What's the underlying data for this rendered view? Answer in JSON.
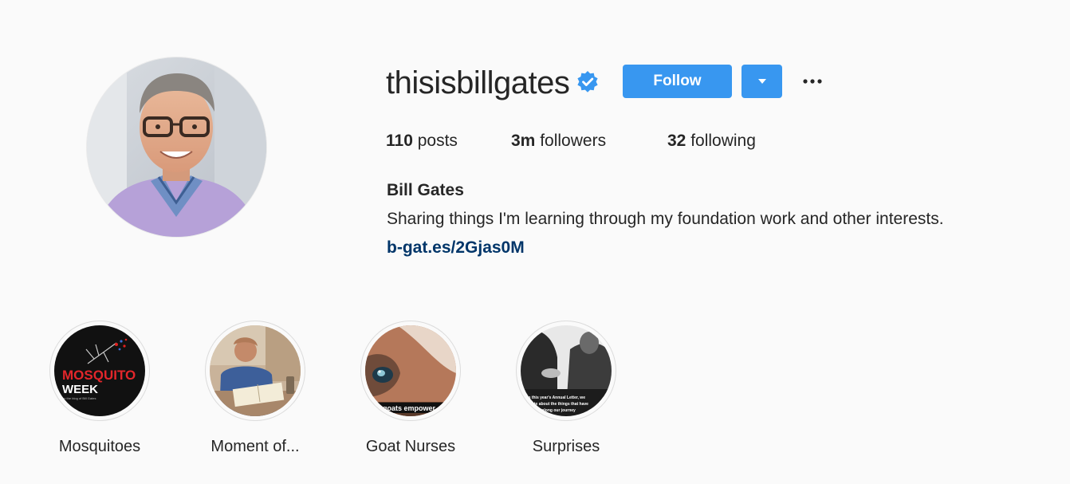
{
  "profile": {
    "username": "thisisbillgates",
    "verified": true,
    "follow_label": "Follow",
    "stats": {
      "posts_count": "110",
      "posts_label": "posts",
      "followers_count": "3m",
      "followers_label": "followers",
      "following_count": "32",
      "following_label": "following"
    },
    "full_name": "Bill Gates",
    "bio": "Sharing things I'm learning through my foundation work and other interests.",
    "link": "b-gat.es/2Gjas0M"
  },
  "highlights": [
    {
      "label": "Mosquitoes",
      "cover": {
        "title_line1": "MOSQUITO",
        "title_line2": "WEEK",
        "subtitle": "on the blog of Bill Gates"
      }
    },
    {
      "label": "Moment of..."
    },
    {
      "label": "Goat Nurses",
      "cover": {
        "caption": "g goats empower"
      }
    },
    {
      "label": "Surprises",
      "cover": {
        "caption_line1": "In this year's Annual Letter, we",
        "caption_line2": "wrote about the things that have",
        "caption_line3": "ised us along our journey"
      }
    }
  ],
  "colors": {
    "accent": "#3897f0",
    "link": "#003569",
    "background": "#fafafa",
    "text": "#262626"
  },
  "icons": {
    "verified": "verified-badge-icon",
    "dropdown": "caret-down-icon",
    "more": "more-horizontal-icon"
  }
}
